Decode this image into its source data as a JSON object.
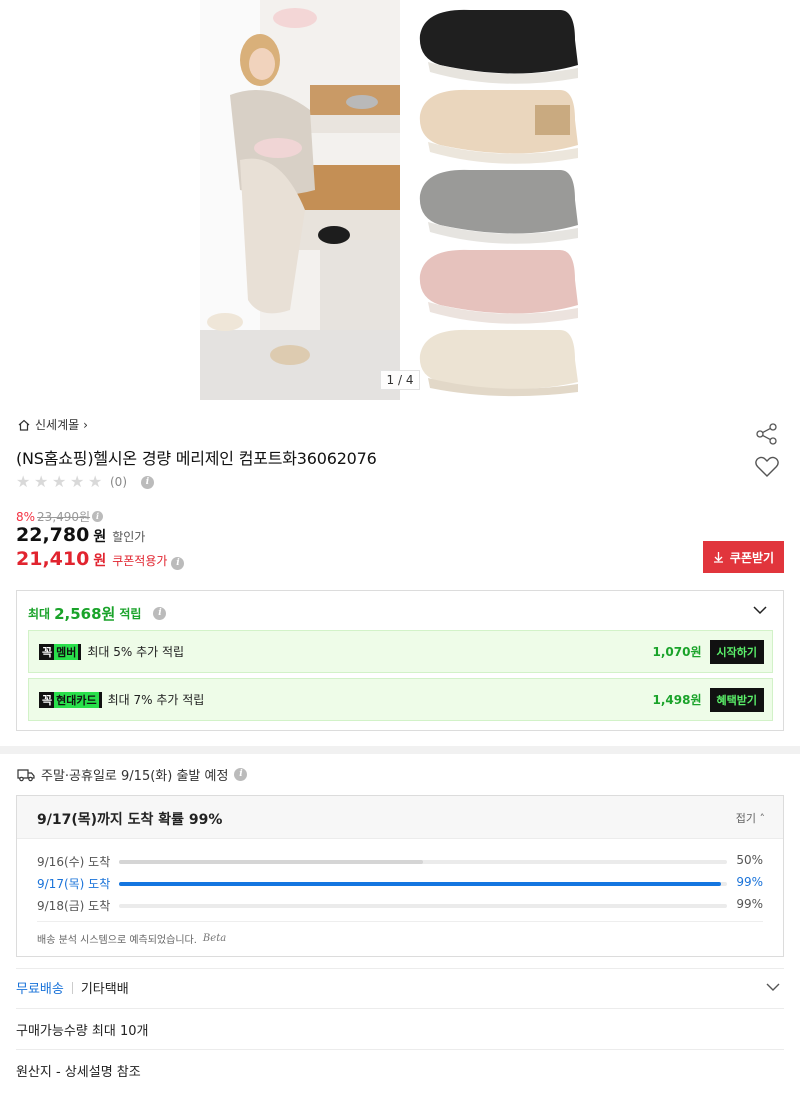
{
  "gallery": {
    "counter": "1 / 4"
  },
  "store": {
    "name": "신세계몰",
    "arrow": "›"
  },
  "product": {
    "title": "(NS홈쇼핑)헬시온 경량 메리제인 컴포트화36062076"
  },
  "rating": {
    "stars": 0,
    "count": "(0)"
  },
  "price": {
    "discount_pct": "8%",
    "original": "23,490원",
    "sale": "22,780",
    "sale_unit": "원",
    "sale_tag": "할인가",
    "coupon_price": "21,410",
    "coupon_unit": "원",
    "coupon_tag": "쿠폰적용가"
  },
  "coupon_button": "쿠폰받기",
  "reward": {
    "prefix": "최대",
    "amount": "2,568원",
    "suffix": "적립",
    "rows": [
      {
        "badge_a": "꼭",
        "badge_b": "멤버",
        "text": "최대 5% 추가 적립",
        "amount": "1,070원",
        "button": "시작하기"
      },
      {
        "badge_a": "꼭",
        "badge_b": "현대카드",
        "text": "최대 7% 추가 적립",
        "amount": "1,498원",
        "button": "혜택받기"
      }
    ]
  },
  "shipping": {
    "depart_text": "주말·공휴일로 9/15(화) 출발 예정",
    "headline": "9/17(목)까지 도착 확률 99%",
    "fold": "접기",
    "probabilities": [
      {
        "label": "9/16(수) 도착",
        "value": "50%",
        "fraction": 0.5,
        "active": false
      },
      {
        "label": "9/17(목) 도착",
        "value": "99%",
        "fraction": 0.99,
        "active": true
      },
      {
        "label": "9/18(금) 도착",
        "value": "99%",
        "fraction": 0.0,
        "active": false
      }
    ],
    "note": "배송 분석 시스템으로 예측되었습니다.",
    "beta": "Beta"
  },
  "delivery_options": {
    "free": "무료배송",
    "other": "기타택배"
  },
  "purchase_limit": "구매가능수량 최대 10개",
  "origin": "원산지 - 상세설명 참조",
  "colors": {
    "red": "#e1242f",
    "green": "#1aa32a",
    "blue": "#1a73d9"
  }
}
